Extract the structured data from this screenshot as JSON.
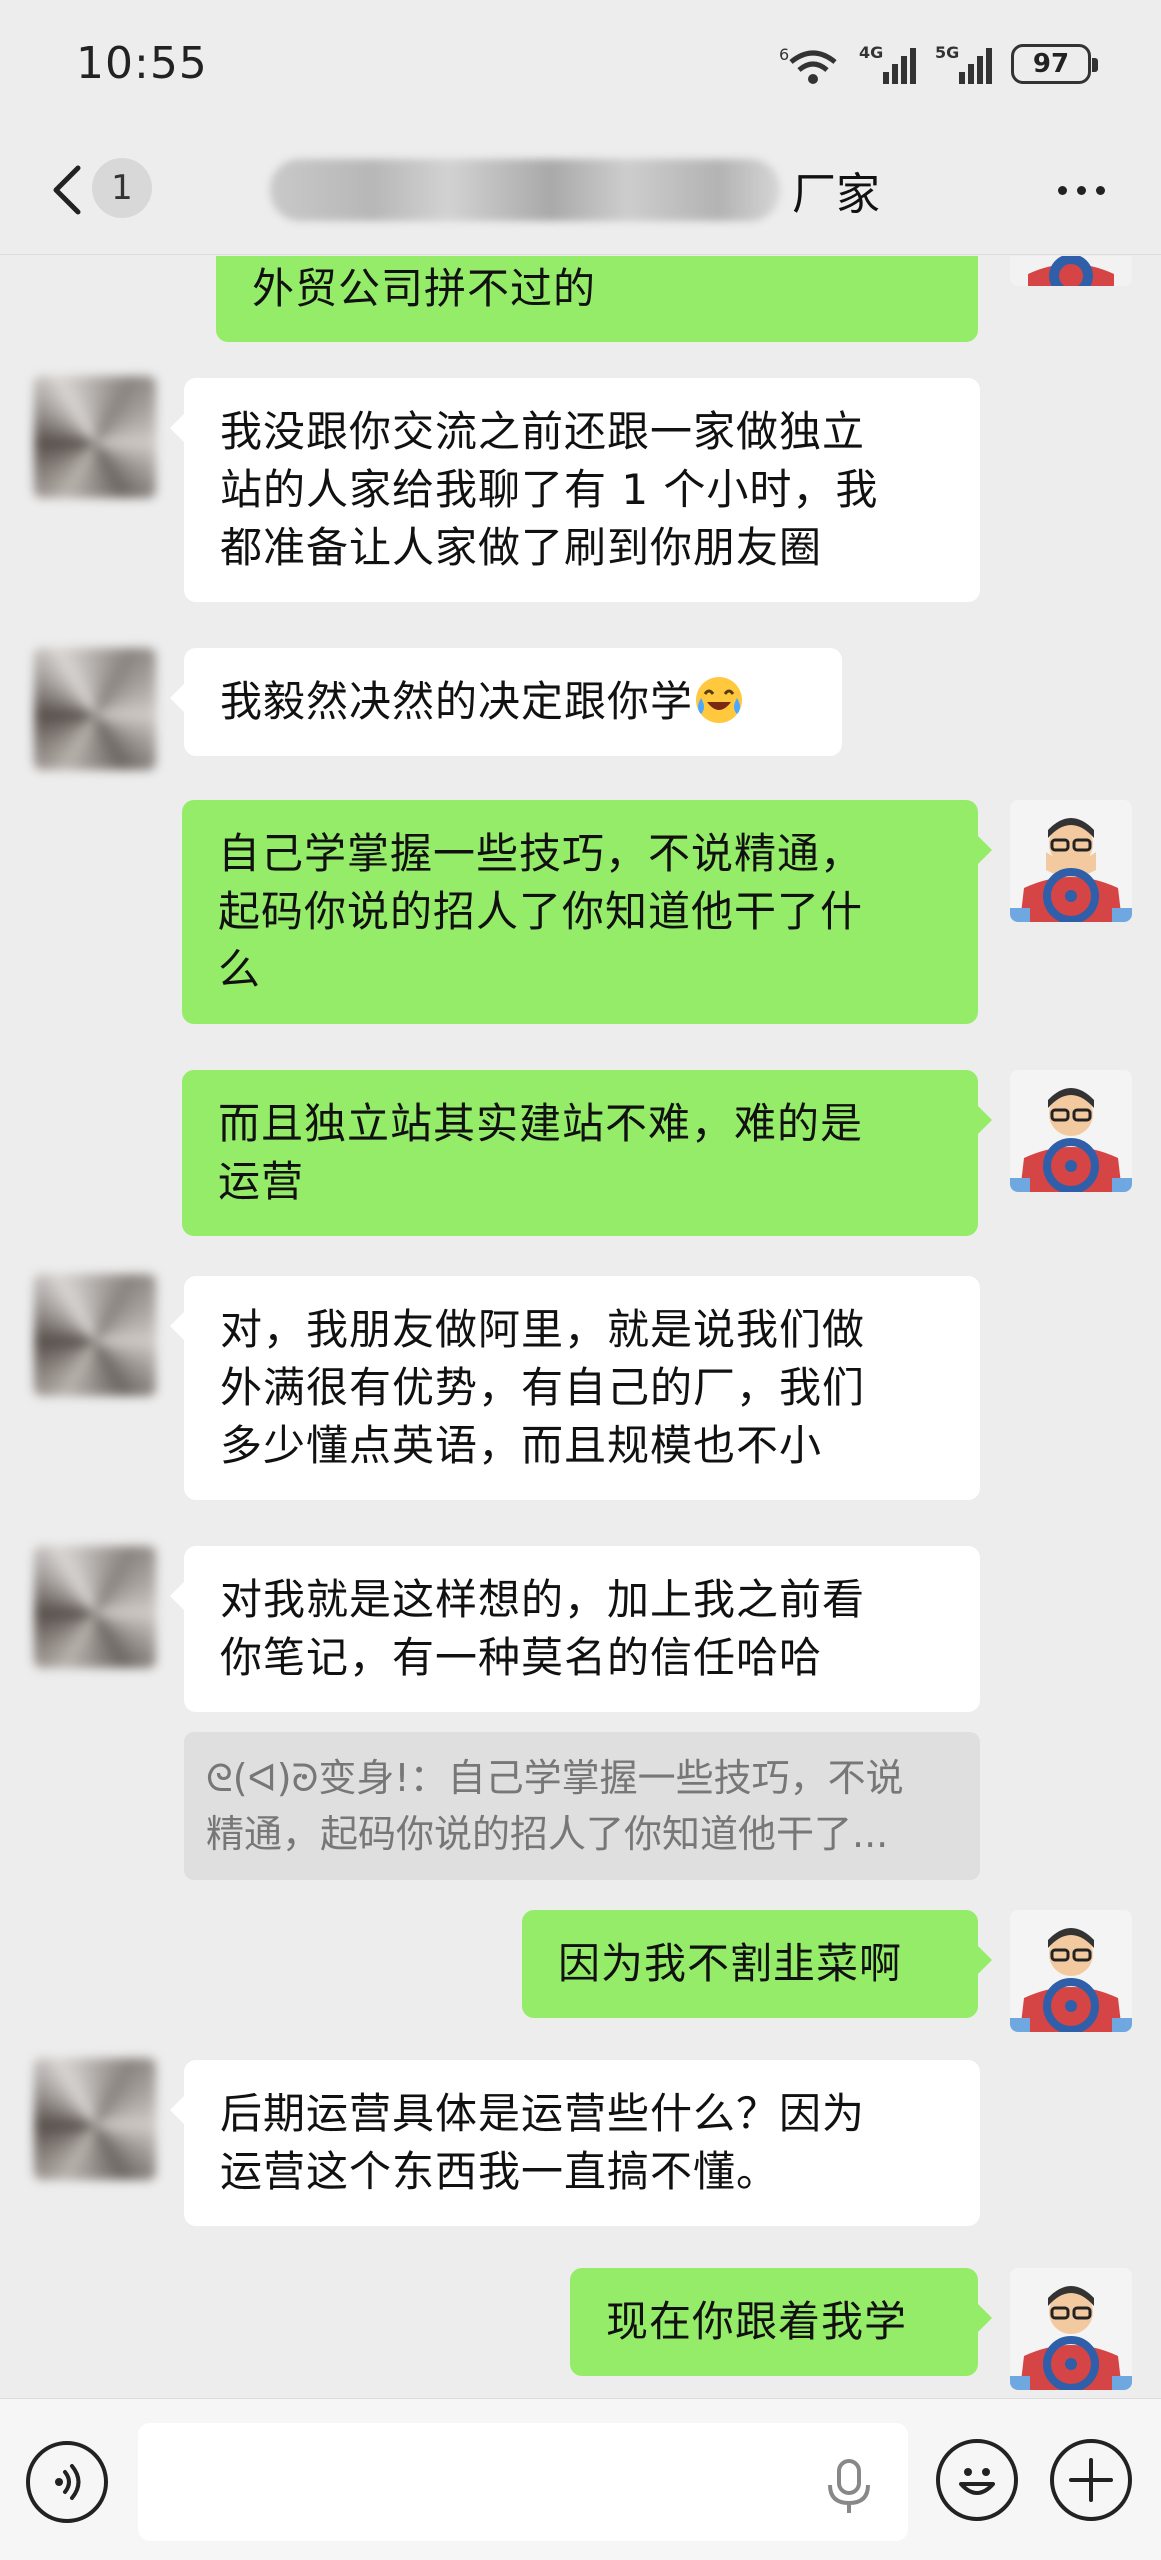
{
  "status_bar": {
    "time": "10:55",
    "signal_labels": [
      "6",
      "4G",
      "5G"
    ],
    "battery": "97"
  },
  "nav": {
    "back_badge": "1",
    "title_visible": "厂家"
  },
  "messages": [
    {
      "side": "out",
      "text": "外贸公司拼不过的"
    },
    {
      "side": "in",
      "lines": [
        "我没跟你交流之前还跟一家做独立",
        "站的人家给我聊了有 1 个小时，我",
        "都准备让人家做了刷到你朋友圈"
      ]
    },
    {
      "side": "in",
      "text": "我毅然决然的决定跟你学"
    },
    {
      "side": "out",
      "lines": [
        "自己学掌握一些技巧，不说精通，",
        "起码你说的招人了你知道他干了什",
        "么"
      ]
    },
    {
      "side": "out",
      "lines": [
        "而且独立站其实建站不难，难的是",
        "运营"
      ]
    },
    {
      "side": "in",
      "lines": [
        "对，我朋友做阿里，就是说我们做",
        "外满很有优势，有自己的厂，我们",
        "多少懂点英语，而且规模也不小"
      ]
    },
    {
      "side": "in",
      "lines": [
        "对我就是这样想的，加上我之前看",
        "你笔记，有一种莫名的信任哈哈"
      ]
    },
    {
      "side": "quote",
      "lines": [
        "ᘓ(ᐊ)ᘒ变身!：自己学掌握一些技巧，不说",
        "精通，起码你说的招人了你知道他干了..."
      ]
    },
    {
      "side": "out",
      "text": "因为我不割韭菜啊"
    },
    {
      "side": "in",
      "lines": [
        "后期运营具体是运营些什么？因为",
        "运营这个东西我一直搞不懂。"
      ]
    },
    {
      "side": "out",
      "text": "现在你跟着我学"
    }
  ],
  "input": {
    "placeholder": ""
  },
  "colors": {
    "background": "#ededed",
    "bubble_out": "#95ec69",
    "bubble_in": "#ffffff",
    "quote_bg": "#dfdfdf"
  },
  "icons": [
    "back-chevron-icon",
    "more-dots-icon",
    "wifi-icon",
    "signal-4g-icon",
    "signal-5g-icon",
    "battery-icon",
    "voice-icon",
    "mic-icon",
    "emoji-face-icon",
    "plus-icon",
    "laughing-cry-emoji"
  ]
}
